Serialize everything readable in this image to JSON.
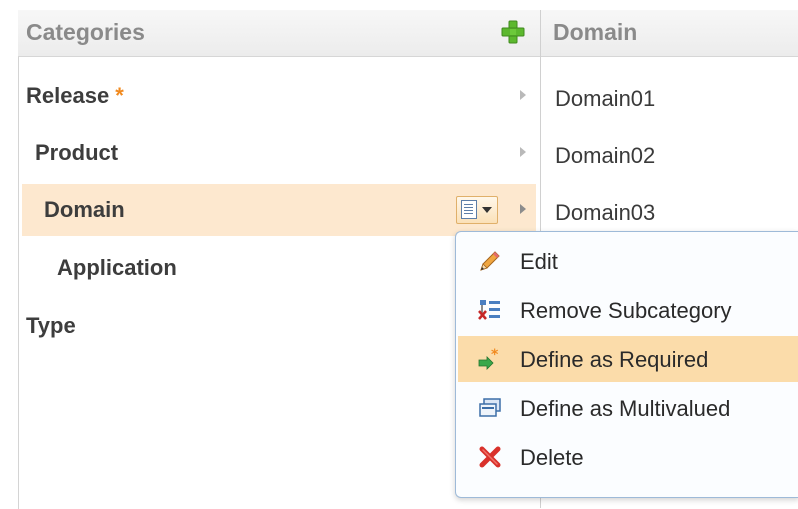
{
  "categories_panel": {
    "header": "Categories",
    "items": [
      {
        "label": "Release",
        "required_marker": "*"
      },
      {
        "label": "Product"
      },
      {
        "label": "Domain"
      },
      {
        "label": "Application"
      },
      {
        "label": "Type"
      }
    ]
  },
  "domain_panel": {
    "header": "Domain",
    "items": [
      "Domain01",
      "Domain02",
      "Domain03"
    ]
  },
  "context_menu": {
    "items": [
      {
        "label": "Edit",
        "icon": "pencil-icon"
      },
      {
        "label": "Remove Subcategory",
        "icon": "remove-subcategory-icon"
      },
      {
        "label": "Define as Required",
        "icon": "define-required-icon"
      },
      {
        "label": "Define as Multivalued",
        "icon": "define-multivalued-icon"
      },
      {
        "label": "Delete",
        "icon": "delete-x-icon"
      }
    ],
    "highlighted": "Define as Required"
  },
  "colors": {
    "selected_row": "#fde8cf",
    "menu_highlight": "#fbdcaa",
    "required_star": "#f18a1f",
    "add_icon": "#5cb82e"
  }
}
